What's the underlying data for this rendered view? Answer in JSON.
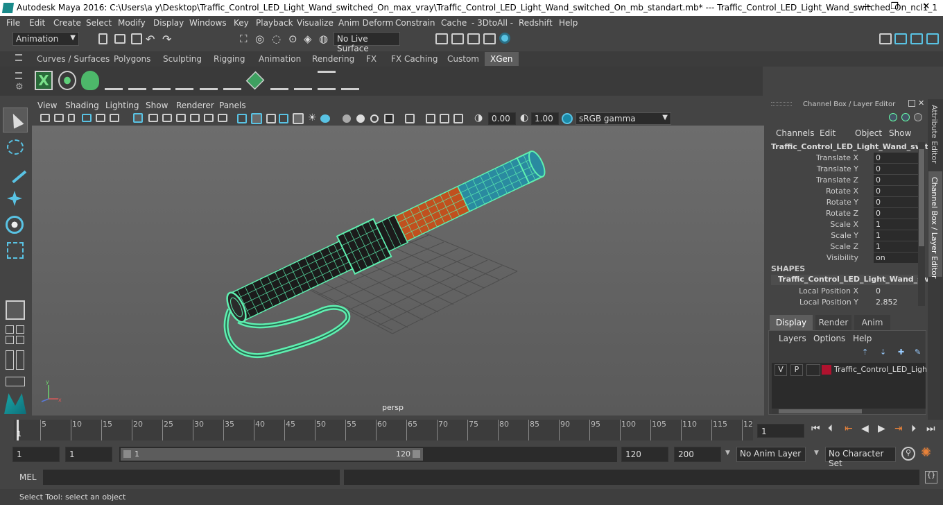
{
  "title_bar": {
    "title": "Autodesk Maya 2016: C:\\Users\\a y\\Desktop\\Traffic_Control_LED_Light_Wand_switched_On_max_vray\\Traffic_Control_LED_Light_Wand_switched_On_mb_standart.mb*   ---   Traffic_Control_LED_Light_Wand_switched_On_ncl1_1",
    "minimize": "—",
    "maximize": "❐",
    "close": "✕"
  },
  "menu": [
    "File",
    "Edit",
    "Create",
    "Select",
    "Modify",
    "Display",
    "Windows",
    "Key",
    "Playback",
    "Visualize",
    "Anim Deform",
    "Constrain",
    "Cache",
    "- 3DtoAll -",
    "Redshift",
    "Help"
  ],
  "status_line": {
    "menu_set": "Animation",
    "live_surface": "No Live Surface"
  },
  "shelf_tabs": [
    "Curves / Surfaces",
    "Polygons",
    "Sculpting",
    "Rigging",
    "Animation",
    "Rendering",
    "FX",
    "FX Caching",
    "Custom",
    "XGen"
  ],
  "active_shelf_tab": "XGen",
  "viewport": {
    "menus": [
      "View",
      "Shading",
      "Lighting",
      "Show",
      "Renderer",
      "Panels"
    ],
    "exposure": "0.00",
    "gamma": "1.00",
    "color_space": "sRGB gamma",
    "camera_label": "persp"
  },
  "channel_box": {
    "panel_title": "Channel Box / Layer Editor",
    "menus": [
      "Channels",
      "Edit",
      "Object",
      "Show"
    ],
    "object_name": "Traffic_Control_LED_Light_Wand_swit...",
    "channels": [
      {
        "label": "Translate X",
        "value": "0"
      },
      {
        "label": "Translate Y",
        "value": "0"
      },
      {
        "label": "Translate Z",
        "value": "0"
      },
      {
        "label": "Rotate X",
        "value": "0"
      },
      {
        "label": "Rotate Y",
        "value": "0"
      },
      {
        "label": "Rotate Z",
        "value": "0"
      },
      {
        "label": "Scale X",
        "value": "1"
      },
      {
        "label": "Scale Y",
        "value": "1"
      },
      {
        "label": "Scale Z",
        "value": "1"
      },
      {
        "label": "Visibility",
        "value": "on"
      }
    ],
    "shapes_header": "SHAPES",
    "shape_name": "Traffic_Control_LED_Light_Wand_sw...",
    "shape_channels": [
      {
        "label": "Local Position X",
        "value": "0"
      },
      {
        "label": "Local Position Y",
        "value": "2.852"
      }
    ]
  },
  "layer_editor": {
    "tabs": [
      "Display",
      "Render",
      "Anim"
    ],
    "active_tab": "Display",
    "menus": [
      "Layers",
      "Options",
      "Help"
    ],
    "layer": {
      "v": "V",
      "p": "P",
      "name": "Traffic_Control_LED_Ligh",
      "color": "#b0122e"
    }
  },
  "side_tabs": [
    "Attribute Editor",
    "Channel Box / Layer Editor"
  ],
  "timeline": {
    "ticks": [
      "1",
      "5",
      "10",
      "15",
      "20",
      "25",
      "30",
      "35",
      "40",
      "45",
      "50",
      "55",
      "60",
      "65",
      "70",
      "75",
      "80",
      "85",
      "90",
      "95",
      "100",
      "105",
      "110",
      "115",
      "12"
    ],
    "current_frame": "1"
  },
  "range": {
    "start": "1",
    "playback_start": "1",
    "slider_start": "1",
    "slider_end": "120",
    "playback_end": "120",
    "end": "200",
    "anim_layer": "No Anim Layer",
    "character_set": "No Character Set"
  },
  "command_line": {
    "label": "MEL"
  },
  "help_line": {
    "text": "Select Tool: select an object"
  },
  "colors": {
    "accent": "#59c3e4",
    "wire": "#5ef0b0",
    "red_section": "#c0501e",
    "cyan_section": "#2a8aa0"
  }
}
